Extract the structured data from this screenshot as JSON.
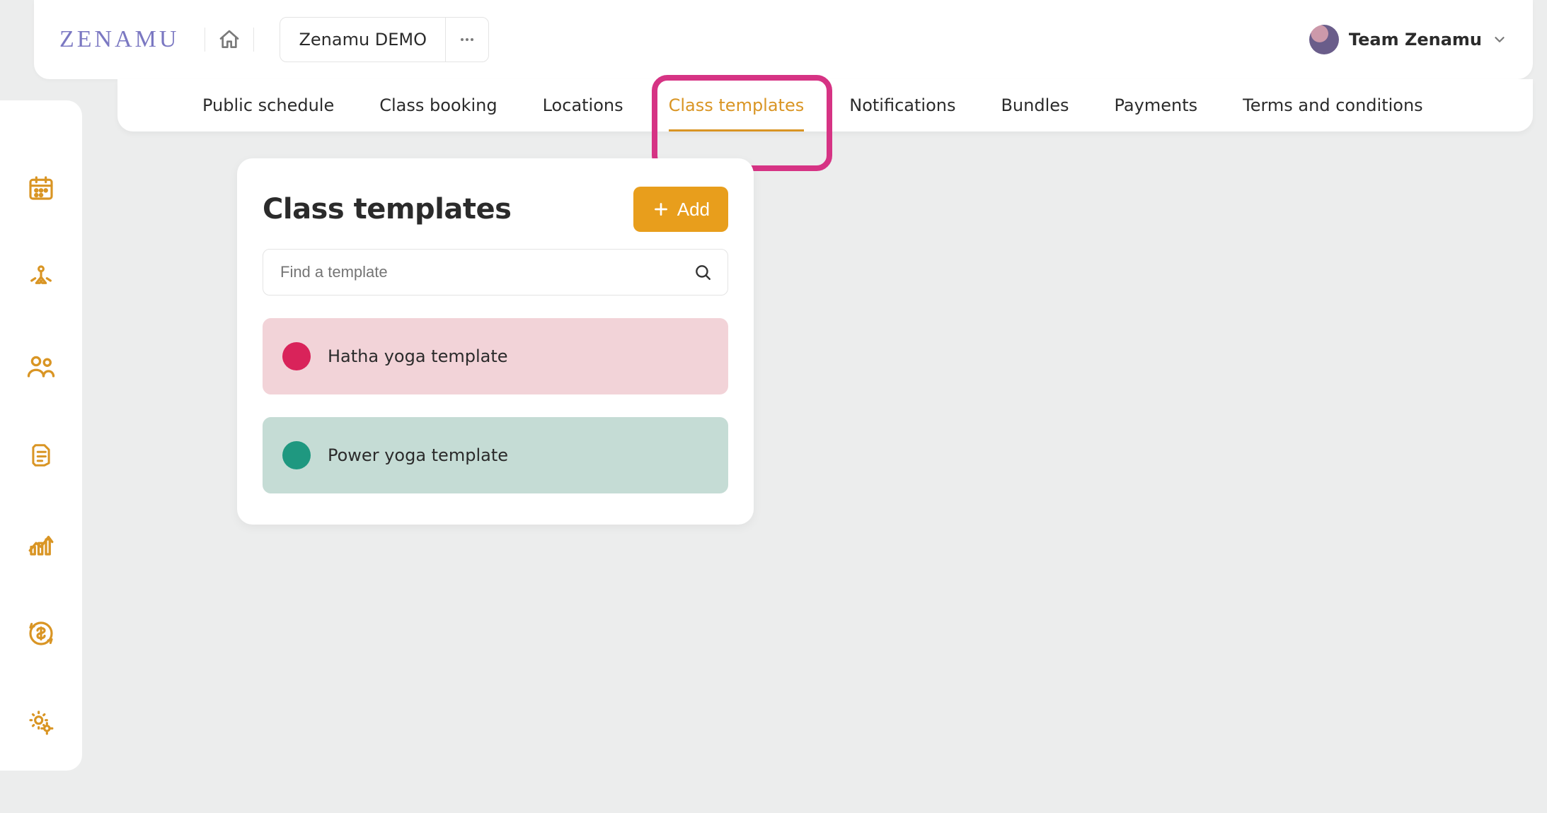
{
  "brand": "ZENAMU",
  "org": {
    "name": "Zenamu DEMO"
  },
  "user": {
    "name": "Team Zenamu"
  },
  "tabs": [
    {
      "label": "Public schedule"
    },
    {
      "label": "Class booking"
    },
    {
      "label": "Locations"
    },
    {
      "label": "Class templates"
    },
    {
      "label": "Notifications"
    },
    {
      "label": "Bundles"
    },
    {
      "label": "Payments"
    },
    {
      "label": "Terms and conditions"
    }
  ],
  "active_tab_index": 3,
  "sidebar": {
    "items": [
      "calendar",
      "yoga",
      "people",
      "document",
      "analytics",
      "billing",
      "settings"
    ],
    "active_index": 6
  },
  "panel": {
    "title": "Class templates",
    "add_label": "Add",
    "search_placeholder": "Find a template",
    "templates": [
      {
        "name": "Hatha yoga template",
        "dot": "#d9235a",
        "bg": "#f2d3d8"
      },
      {
        "name": "Power yoga template",
        "dot": "#1f9880",
        "bg": "#c5dcd5"
      }
    ]
  },
  "highlight": {
    "tab_index": 3
  }
}
